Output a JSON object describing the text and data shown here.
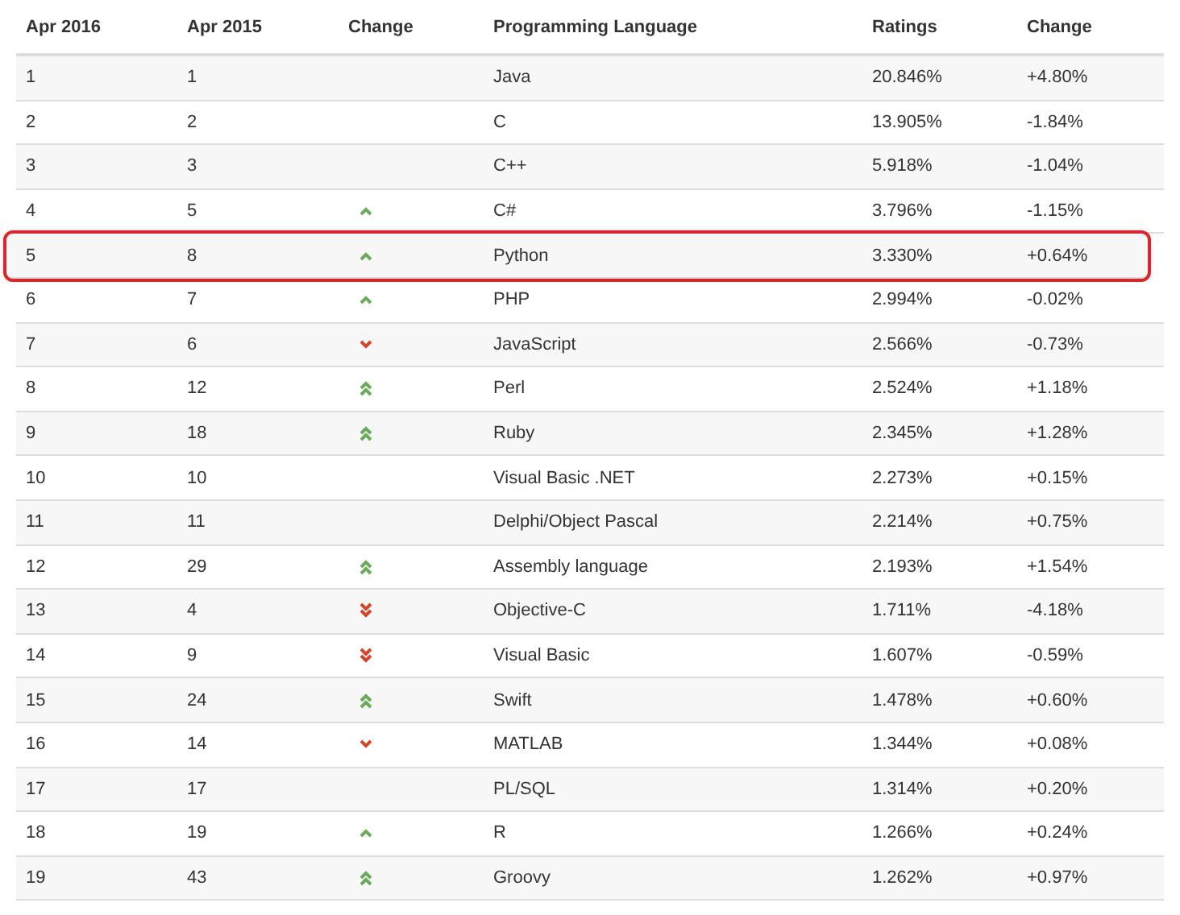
{
  "table": {
    "columns": [
      "Apr 2016",
      "Apr 2015",
      "Change",
      "Programming Language",
      "Ratings",
      "Change"
    ],
    "rows": [
      {
        "apr_2016": "1",
        "apr_2015": "1",
        "kind": "none",
        "language": "Java",
        "rating": "20.846%",
        "change": "+4.80%",
        "highlighted": false
      },
      {
        "apr_2016": "2",
        "apr_2015": "2",
        "kind": "none",
        "language": "C",
        "rating": "13.905%",
        "change": "-1.84%",
        "highlighted": false
      },
      {
        "apr_2016": "3",
        "apr_2015": "3",
        "kind": "none",
        "language": "C++",
        "rating": "5.918%",
        "change": "-1.04%",
        "highlighted": false
      },
      {
        "apr_2016": "4",
        "apr_2015": "5",
        "kind": "up",
        "language": "C#",
        "rating": "3.796%",
        "change": "-1.15%",
        "highlighted": false
      },
      {
        "apr_2016": "5",
        "apr_2015": "8",
        "kind": "up",
        "language": "Python",
        "rating": "3.330%",
        "change": "+0.64%",
        "highlighted": true
      },
      {
        "apr_2016": "6",
        "apr_2015": "7",
        "kind": "up",
        "language": "PHP",
        "rating": "2.994%",
        "change": "-0.02%",
        "highlighted": false
      },
      {
        "apr_2016": "7",
        "apr_2015": "6",
        "kind": "down",
        "language": "JavaScript",
        "rating": "2.566%",
        "change": "-0.73%",
        "highlighted": false
      },
      {
        "apr_2016": "8",
        "apr_2015": "12",
        "kind": "up2",
        "language": "Perl",
        "rating": "2.524%",
        "change": "+1.18%",
        "highlighted": false
      },
      {
        "apr_2016": "9",
        "apr_2015": "18",
        "kind": "up2",
        "language": "Ruby",
        "rating": "2.345%",
        "change": "+1.28%",
        "highlighted": false
      },
      {
        "apr_2016": "10",
        "apr_2015": "10",
        "kind": "none",
        "language": "Visual Basic .NET",
        "rating": "2.273%",
        "change": "+0.15%",
        "highlighted": false
      },
      {
        "apr_2016": "11",
        "apr_2015": "11",
        "kind": "none",
        "language": "Delphi/Object Pascal",
        "rating": "2.214%",
        "change": "+0.75%",
        "highlighted": false
      },
      {
        "apr_2016": "12",
        "apr_2015": "29",
        "kind": "up2",
        "language": "Assembly language",
        "rating": "2.193%",
        "change": "+1.54%",
        "highlighted": false
      },
      {
        "apr_2016": "13",
        "apr_2015": "4",
        "kind": "down2",
        "language": "Objective-C",
        "rating": "1.711%",
        "change": "-4.18%",
        "highlighted": false
      },
      {
        "apr_2016": "14",
        "apr_2015": "9",
        "kind": "down2",
        "language": "Visual Basic",
        "rating": "1.607%",
        "change": "-0.59%",
        "highlighted": false
      },
      {
        "apr_2016": "15",
        "apr_2015": "24",
        "kind": "up2",
        "language": "Swift",
        "rating": "1.478%",
        "change": "+0.60%",
        "highlighted": false
      },
      {
        "apr_2016": "16",
        "apr_2015": "14",
        "kind": "down",
        "language": "MATLAB",
        "rating": "1.344%",
        "change": "+0.08%",
        "highlighted": false
      },
      {
        "apr_2016": "17",
        "apr_2015": "17",
        "kind": "none",
        "language": "PL/SQL",
        "rating": "1.314%",
        "change": "+0.20%",
        "highlighted": false
      },
      {
        "apr_2016": "18",
        "apr_2015": "19",
        "kind": "up",
        "language": "R",
        "rating": "1.266%",
        "change": "+0.24%",
        "highlighted": false
      },
      {
        "apr_2016": "19",
        "apr_2015": "43",
        "kind": "up2",
        "language": "Groovy",
        "rating": "1.262%",
        "change": "+0.97%",
        "highlighted": false
      }
    ]
  }
}
